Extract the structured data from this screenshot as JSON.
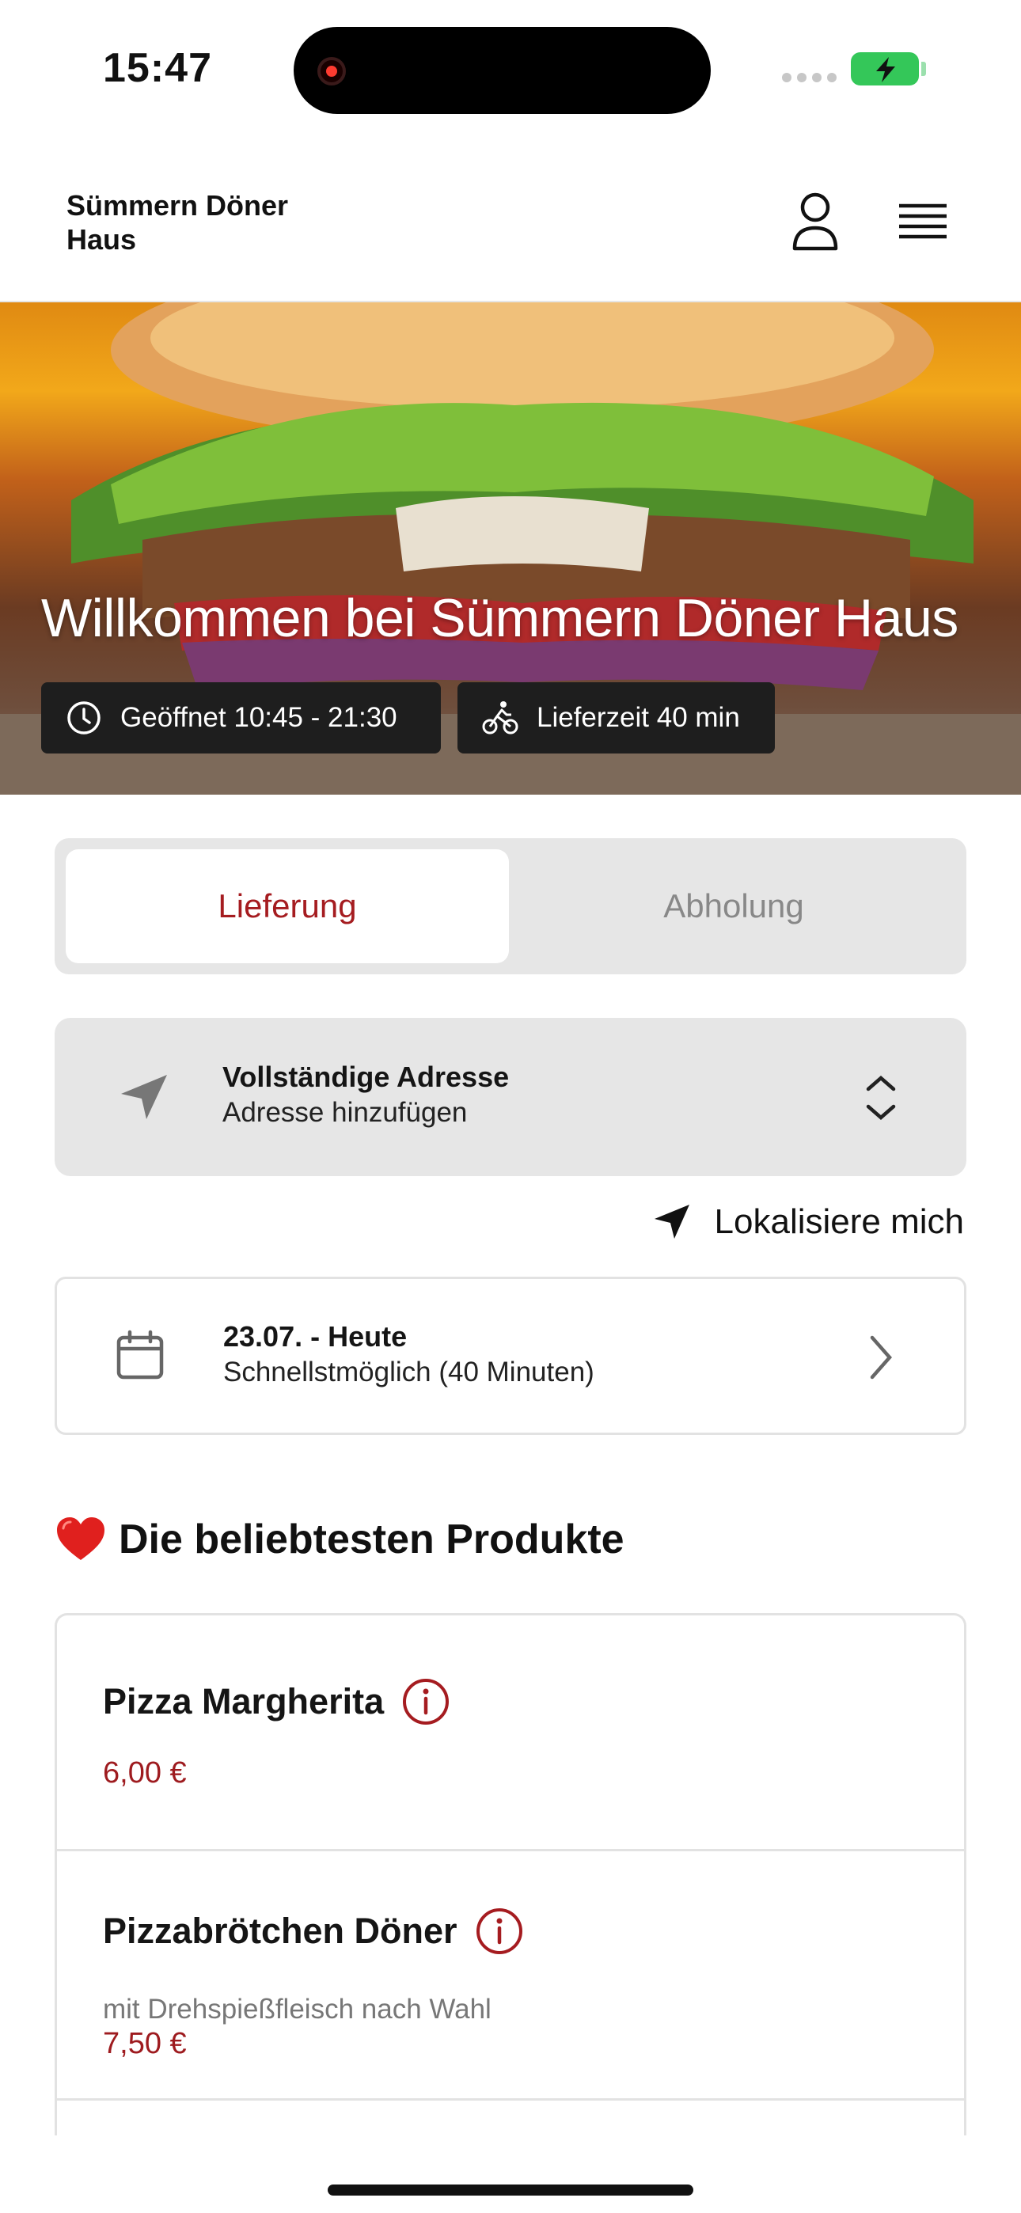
{
  "status_bar": {
    "time": "15:47",
    "icons": [
      "screen-recording-icon",
      "signal-icon",
      "battery-charging-icon"
    ]
  },
  "header": {
    "brand": "Sümmern Döner Haus",
    "icons": [
      "user-icon",
      "hamburger-menu-icon"
    ]
  },
  "hero": {
    "title": "Willkommen bei Sümmern Döner Haus",
    "opening_hours": "Geöffnet 10:45 - 21:30",
    "delivery_time": "Lieferzeit 40 min",
    "icons": [
      "clock-icon",
      "bicycle-icon"
    ]
  },
  "order_mode": {
    "options": [
      "Lieferung",
      "Abholung"
    ],
    "selected": "Lieferung",
    "accent_color": "#a51c20"
  },
  "address": {
    "title": "Vollständige Adresse",
    "subtitle": "Adresse hinzufügen",
    "icons": [
      "location-arrow-icon",
      "chevron-up-down-icon"
    ]
  },
  "locate": {
    "label": "Lokalisiere mich",
    "icon": "location-arrow-icon"
  },
  "schedule": {
    "date": "23.07. - Heute",
    "time": "Schnellstmöglich (40 Minuten)",
    "icons": [
      "calendar-icon",
      "chevron-right-icon"
    ]
  },
  "popular": {
    "title": "Die beliebtesten Produkte",
    "icon": "heart-icon",
    "products": [
      {
        "name": "Pizza Margherita",
        "description": "",
        "price": "6,00 €"
      },
      {
        "name": "Pizzabrötchen Döner",
        "description": "mit Drehspießfleisch nach Wahl",
        "price": "7,50 €"
      }
    ]
  },
  "colors": {
    "accent": "#a51c20",
    "price": "#9e1b1f",
    "segment_bg": "#e6e6e6",
    "badge_bg": "#1e1e1e"
  }
}
